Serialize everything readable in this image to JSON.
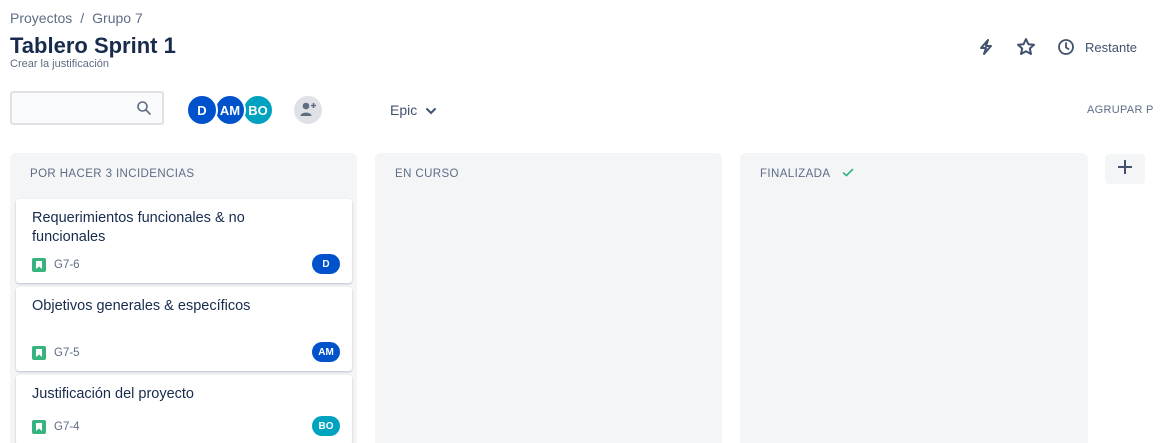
{
  "breadcrumb": {
    "parent": "Proyectos",
    "separator": "/",
    "current": "Grupo 7"
  },
  "page": {
    "title": "Tablero Sprint 1",
    "subtitle": "Crear la justificación"
  },
  "header": {
    "restante_label": "Restante"
  },
  "search": {
    "value": "",
    "placeholder": ""
  },
  "avatars": [
    {
      "initials": "D",
      "color": "#0052cc"
    },
    {
      "initials": "AM",
      "color": "#0052cc"
    },
    {
      "initials": "BO",
      "color": "#00a3bf"
    }
  ],
  "filters": {
    "epic_label": "Epic",
    "group_by_label": "AGRUPAR P"
  },
  "columns": [
    {
      "title": "POR HACER 3 INCIDENCIAS"
    },
    {
      "title": "EN CURSO"
    },
    {
      "title": "FINALIZADA"
    }
  ],
  "cards": [
    {
      "summary": "Requerimientos funcionales & no funcionales",
      "key": "G7-6",
      "assignee": "D",
      "assignee_color": "#0052cc"
    },
    {
      "summary": "Objetivos generales & específicos",
      "key": "G7-5",
      "assignee": "AM",
      "assignee_color": "#0052cc"
    },
    {
      "summary": "Justificación del proyecto",
      "key": "G7-4",
      "assignee": "BO",
      "assignee_color": "#00a3bf"
    }
  ],
  "colors": {
    "story": "#36b37e",
    "done_check": "#36b37e",
    "column_bg": "#f4f5f7"
  }
}
